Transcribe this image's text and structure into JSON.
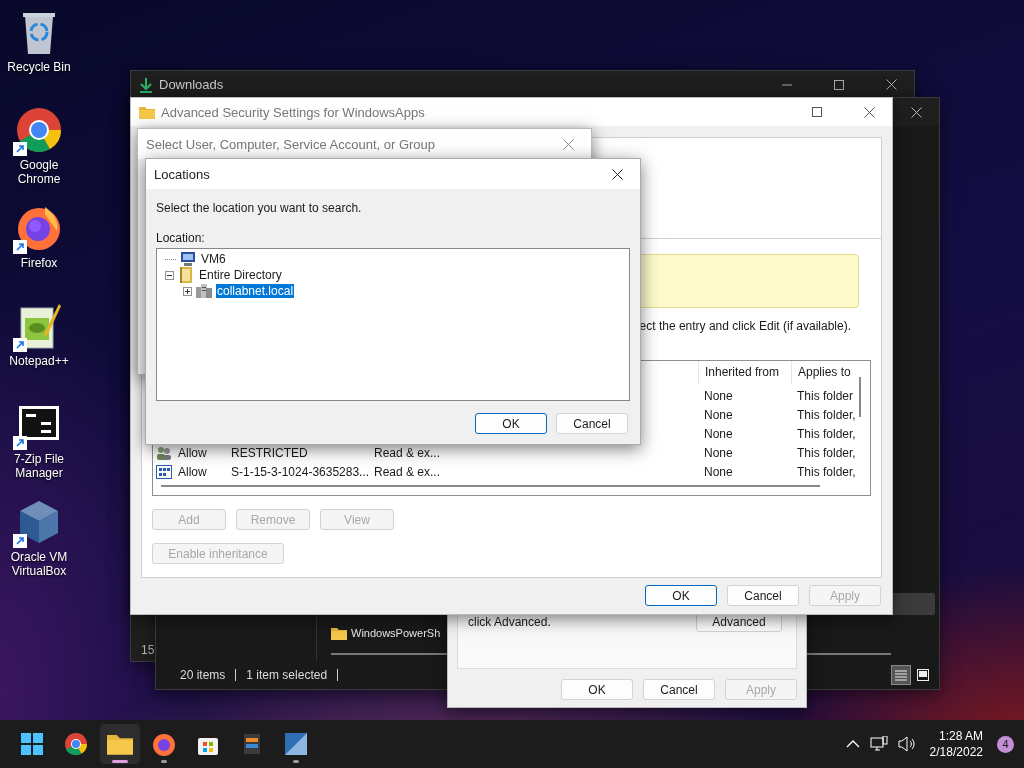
{
  "desktop_icons": [
    {
      "label": "Recycle Bin",
      "shortcut": false
    },
    {
      "label": "Google Chrome",
      "shortcut": true
    },
    {
      "label": "Firefox",
      "shortcut": true
    },
    {
      "label": "Notepad++",
      "shortcut": true
    },
    {
      "label": "7-Zip File Manager",
      "shortcut": true
    },
    {
      "label": "Oracle VM VirtualBox",
      "shortcut": true
    }
  ],
  "downloads_window": {
    "title": "Downloads",
    "column_1": "15"
  },
  "explorer_window": {
    "items": [
      {
        "label": "WindowsPowerSh"
      }
    ],
    "status_bar": [
      "20 items",
      "1 item selected"
    ],
    "view_buttons": [
      {
        "selected": true
      },
      {
        "selected": false
      }
    ]
  },
  "properties_dialog": {
    "hint": "click Advanced.",
    "advanced_button": "Advanced",
    "buttons": [
      {
        "label": "OK",
        "default": false,
        "disabled": false
      },
      {
        "label": "Cancel",
        "default": false,
        "disabled": false
      },
      {
        "label": "Apply",
        "default": false,
        "disabled": true
      }
    ]
  },
  "security_window": {
    "title": "Advanced Security Settings for WindowsApps",
    "instruction": "ect the entry and click Edit (if available).",
    "table": {
      "columns": [
        "Inherited from",
        "Applies to"
      ],
      "rows": [
        {
          "inherited_from": "None",
          "applies_to": "This folder"
        },
        {
          "inherited_from": "None",
          "applies_to": "This folder,"
        },
        {
          "inherited_from": "None",
          "applies_to": "This folder,"
        },
        {
          "kind": "group",
          "type": "Allow",
          "principal": "RESTRICTED",
          "access": "Read & ex...",
          "inherited_from": "None",
          "applies_to": "This folder,"
        },
        {
          "kind": "package",
          "type": "Allow",
          "principal": "S-1-15-3-1024-3635283...",
          "access": "Read & ex...",
          "inherited_from": "None",
          "applies_to": "This folder,"
        }
      ]
    },
    "action_buttons": [
      {
        "label": "Add",
        "disabled": true
      },
      {
        "label": "Remove",
        "disabled": true
      },
      {
        "label": "View",
        "disabled": true
      }
    ],
    "inheritance_button": {
      "label": "Enable inheritance",
      "disabled": true
    },
    "buttons": [
      {
        "label": "OK",
        "default": true,
        "disabled": false
      },
      {
        "label": "Cancel",
        "default": false,
        "disabled": false
      },
      {
        "label": "Apply",
        "default": false,
        "disabled": true
      }
    ]
  },
  "select_user_dialog": {
    "title": "Select User, Computer, Service Account, or Group"
  },
  "locations_dialog": {
    "title": "Locations",
    "prompt": "Select the location you want to search.",
    "label": "Location:",
    "tree": [
      {
        "kind": "computer",
        "label": "VM6",
        "selected": false
      },
      {
        "kind": "directory",
        "label": "Entire Directory",
        "selected": false,
        "expanded": true,
        "children": [
          {
            "kind": "domain",
            "label": "collabnet.local",
            "selected": true,
            "expanded": false
          }
        ]
      }
    ],
    "buttons": [
      {
        "label": "OK",
        "default": true,
        "disabled": false
      },
      {
        "label": "Cancel",
        "default": false,
        "disabled": false
      }
    ]
  },
  "taskbar": {
    "apps": [
      {
        "running": false,
        "active": false
      },
      {
        "running": true,
        "active": true
      },
      {
        "running": true,
        "active": false
      },
      {
        "running": false,
        "active": false
      },
      {
        "running": false,
        "active": false
      },
      {
        "running": true,
        "active": false
      }
    ],
    "time": "1:28 AM",
    "date": "2/18/2022",
    "notification_count": "4"
  }
}
